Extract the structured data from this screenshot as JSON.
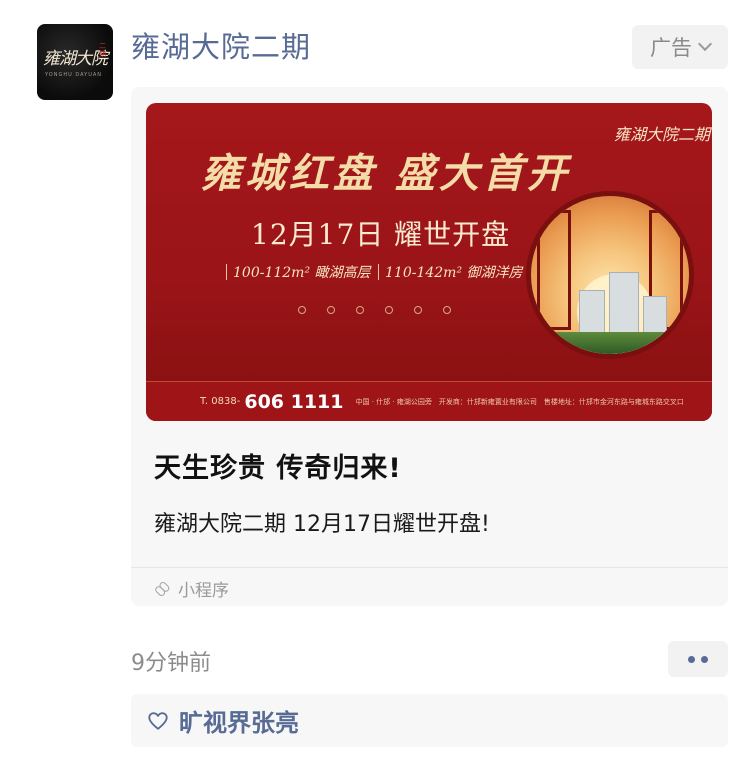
{
  "post": {
    "account_name": "雍湖大院二期",
    "ad_label": "广告",
    "avatar": {
      "logo_text": "雍湖大院",
      "logo_side_text": "二期",
      "logo_sub": "YONGHU DAYUAN"
    },
    "banner": {
      "slogan": "雍城红盘 盛大首开",
      "date_line": "12月17日 耀世开盘",
      "spec_left": "100-112m² 瞰湖高层",
      "spec_right": "110-142m² 御湖洋房",
      "brand": "雍湖大院二期",
      "phone_label": "T. 0838-",
      "phone_number": "606 1111",
      "footer_info": "中国 · 什邡 · 雍湖公园旁　开发商：什邡新雍置业有限公司　售楼地址：什邡市金河东路与雍城东路交叉口"
    },
    "headline": "天生珍贵 传奇归来!",
    "description": "雍湖大院二期 12月17日耀世开盘!",
    "mini_program_label": "小程序",
    "timestamp": "9分钟前",
    "likes": "旷视界张亮"
  },
  "colors": {
    "name_blue": "#576b95",
    "banner_red": "#a5171b",
    "gold": "#f3dca7"
  },
  "icons": [
    "chevron-down-icon",
    "link-icon",
    "more-icon",
    "heart-icon"
  ]
}
